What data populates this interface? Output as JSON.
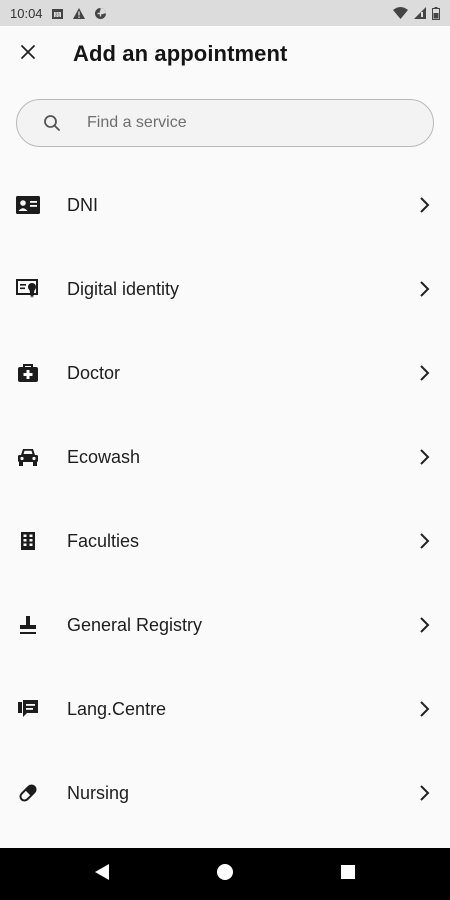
{
  "status_bar": {
    "time": "10:04",
    "icons": [
      "calendar-icon",
      "warning-icon",
      "data-saver-icon",
      "wifi-icon",
      "signal-icon",
      "battery-icon"
    ]
  },
  "header": {
    "title": "Add an appointment",
    "close_icon": "close-icon"
  },
  "search": {
    "placeholder": "Find a service",
    "value": "",
    "icon": "search-icon"
  },
  "services": [
    {
      "label": "DNI",
      "icon": "id-card-icon"
    },
    {
      "label": "Digital identity",
      "icon": "digital-certificate-icon"
    },
    {
      "label": "Doctor",
      "icon": "medical-bag-icon"
    },
    {
      "label": "Ecowash",
      "icon": "car-icon"
    },
    {
      "label": "Faculties",
      "icon": "building-icon"
    },
    {
      "label": "General Registry",
      "icon": "stamp-icon"
    },
    {
      "label": "Lang.Centre",
      "icon": "chat-icon"
    },
    {
      "label": "Nursing",
      "icon": "pill-icon"
    }
  ],
  "nav_bar": {
    "buttons": [
      "back-icon",
      "home-icon",
      "recents-icon"
    ]
  },
  "colors": {
    "background": "#fafafa",
    "status_bar": "#dcdcdc",
    "nav_bar": "#000000",
    "text": "#1c1c1c",
    "search_border": "#b9b9b9"
  }
}
